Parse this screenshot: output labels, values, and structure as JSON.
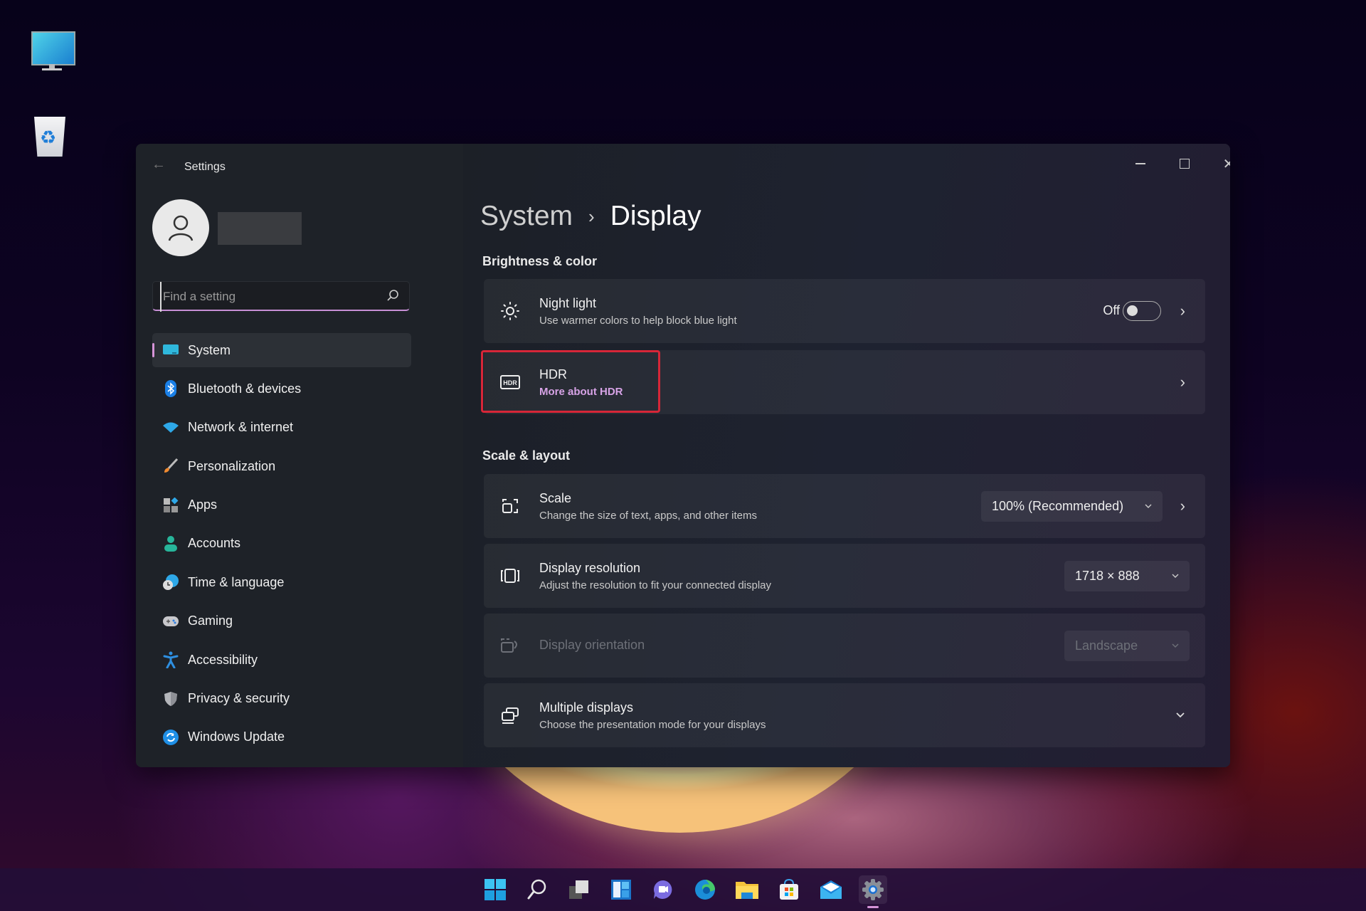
{
  "desktop": {
    "icons": [
      {
        "name": "this-pc-icon"
      },
      {
        "name": "recycle-bin-icon"
      }
    ]
  },
  "window": {
    "title": "Settings",
    "controls": {
      "minimize": "minimize",
      "maximize": "maximize",
      "close": "close"
    }
  },
  "sidebar": {
    "search_placeholder": "Find a setting",
    "search_value": "",
    "items": [
      {
        "label": "System",
        "icon": "monitor-icon",
        "active": true
      },
      {
        "label": "Bluetooth & devices",
        "icon": "bluetooth-icon"
      },
      {
        "label": "Network & internet",
        "icon": "wifi-icon"
      },
      {
        "label": "Personalization",
        "icon": "brush-icon"
      },
      {
        "label": "Apps",
        "icon": "apps-icon"
      },
      {
        "label": "Accounts",
        "icon": "person-icon"
      },
      {
        "label": "Time & language",
        "icon": "globe-clock-icon"
      },
      {
        "label": "Gaming",
        "icon": "gamepad-icon"
      },
      {
        "label": "Accessibility",
        "icon": "accessibility-icon"
      },
      {
        "label": "Privacy & security",
        "icon": "shield-icon"
      },
      {
        "label": "Windows Update",
        "icon": "update-icon"
      }
    ]
  },
  "main": {
    "breadcrumb": {
      "parent": "System",
      "separator": "›",
      "current": "Display"
    },
    "sections": [
      {
        "heading": "Brightness & color",
        "cards": [
          {
            "title": "Night light",
            "subtitle": "Use warmer colors to help block blue light",
            "icon": "sun-icon",
            "toggle_label": "Off",
            "toggle_on": false
          },
          {
            "title": "HDR",
            "link": "More about HDR",
            "icon": "hdr-icon",
            "highlighted": true
          }
        ]
      },
      {
        "heading": "Scale & layout",
        "cards": [
          {
            "title": "Scale",
            "subtitle": "Change the size of text, apps, and other items",
            "icon": "scale-icon",
            "dropdown_value": "100% (Recommended)"
          },
          {
            "title": "Display resolution",
            "subtitle": "Adjust the resolution to fit your connected display",
            "icon": "resolution-icon",
            "dropdown_value": "1718 × 888"
          },
          {
            "title": "Display orientation",
            "icon": "orientation-icon",
            "dropdown_value": "Landscape",
            "disabled": true
          },
          {
            "title": "Multiple displays",
            "subtitle": "Choose the presentation mode for your displays",
            "icon": "multiple-displays-icon",
            "expandable": true
          }
        ]
      }
    ]
  },
  "taskbar": {
    "items": [
      "start",
      "search",
      "task-view",
      "widgets",
      "chat",
      "edge",
      "file-explorer",
      "store",
      "mail",
      "settings"
    ],
    "active": "settings"
  },
  "colors": {
    "accent": "#d694d8",
    "highlight_border": "#d72638",
    "link": "#d7a3e6"
  }
}
